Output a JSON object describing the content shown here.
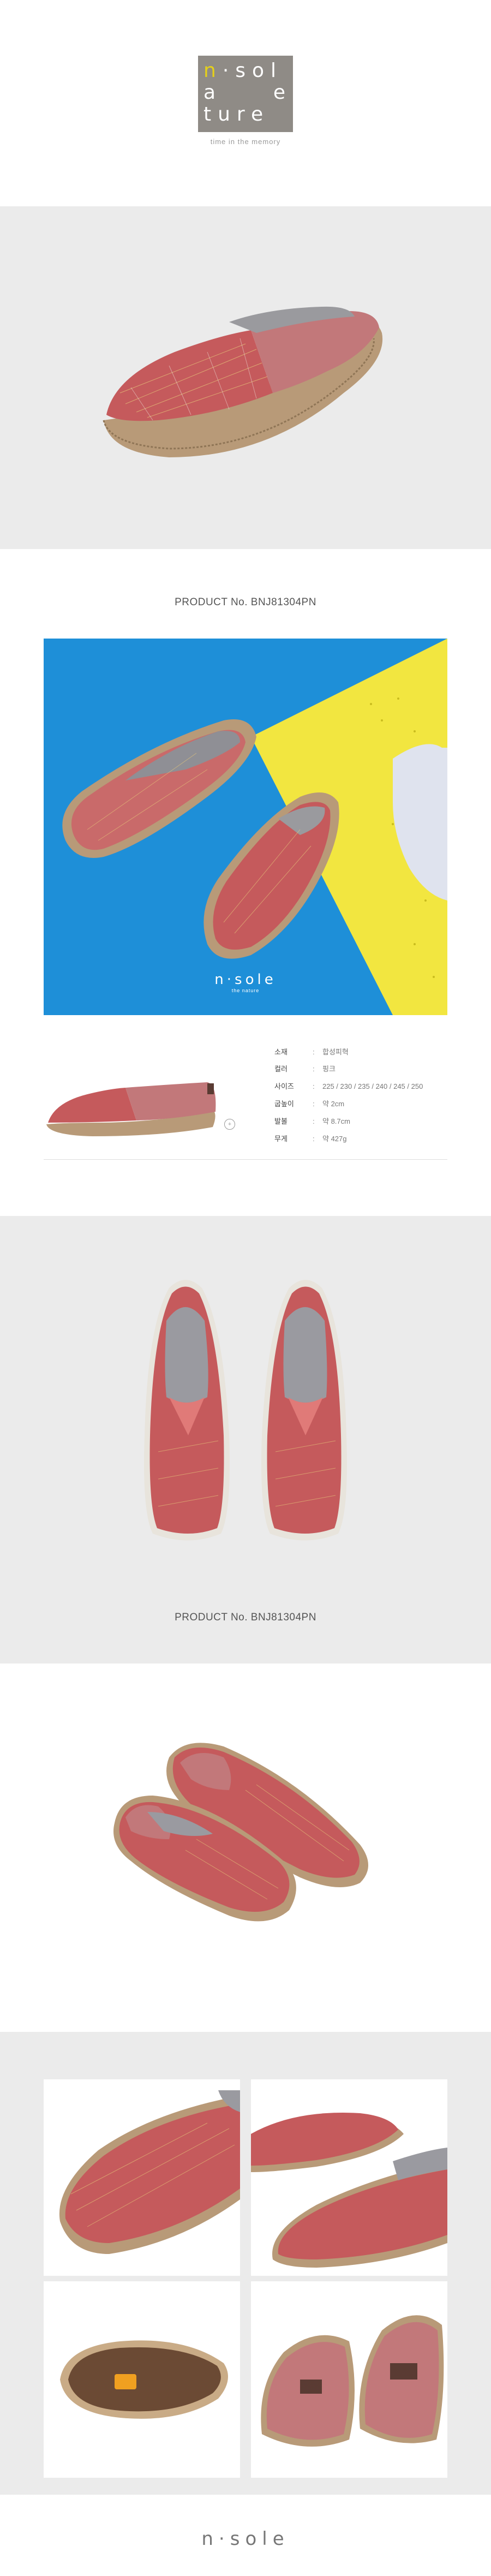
{
  "brand": {
    "logo_row1": "n·sol",
    "logo_row2": "a  e",
    "logo_row3": "ture",
    "tagline": "time in the memory",
    "footer_logo": "n·sole"
  },
  "product": {
    "number_label": "PRODUCT No. BNJ81304PN",
    "photo_brand": "n·sole",
    "photo_brand_sub": "the nature"
  },
  "specs": [
    {
      "label": "소재",
      "value": "합성피혁"
    },
    {
      "label": "컬러",
      "value": "핑크"
    },
    {
      "label": "사이즈",
      "value": "225 / 230 / 235 / 240 / 245 / 250"
    },
    {
      "label": "굽높이",
      "value": "약 2cm"
    },
    {
      "label": "발볼",
      "value": "약 8.7cm"
    },
    {
      "label": "무게",
      "value": "약 427g"
    }
  ],
  "colors": {
    "canvas": "#c55a5c",
    "leather": "#c2787a",
    "rope": "#b89a78",
    "blue": "#1e8fd8",
    "yellow": "#f2e640"
  }
}
